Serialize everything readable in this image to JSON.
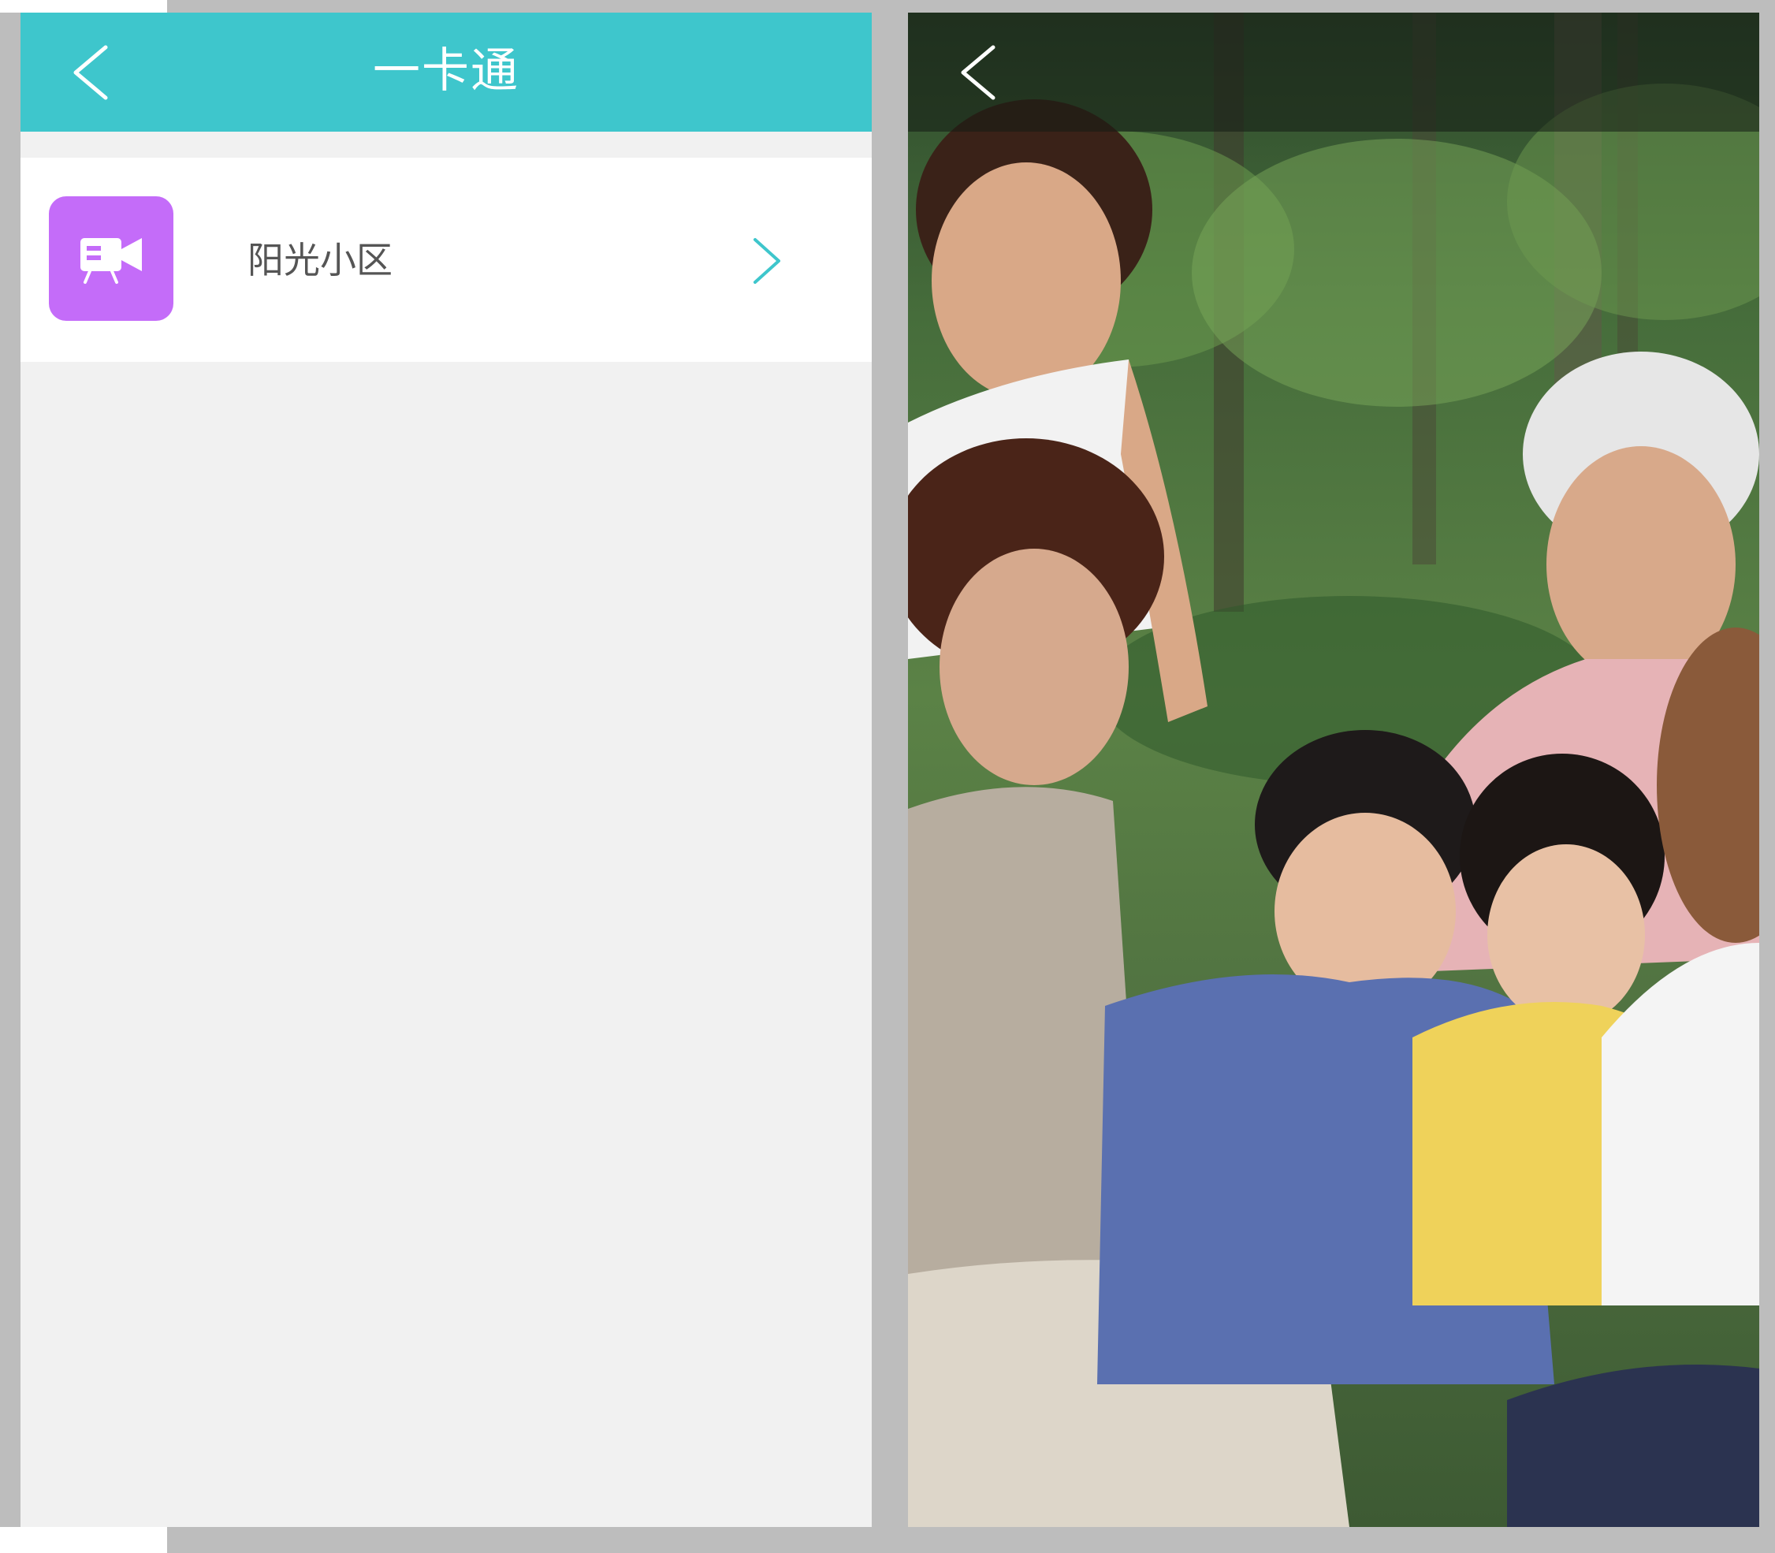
{
  "left_screen": {
    "nav": {
      "title": "一卡通",
      "back_icon": "chevron-left-icon"
    },
    "list": [
      {
        "label": "阳光小区",
        "icon": "video-camera-icon",
        "arrow": "chevron-right-icon"
      }
    ]
  },
  "right_screen": {
    "nav": {
      "back_icon": "chevron-left-icon"
    },
    "photo": "family-outdoor-photo"
  },
  "colors": {
    "accent": "#3ec6cc",
    "icon_bg": "#c46cf9",
    "page_bg": "#f1f1f1",
    "frame": "#bdbdbd"
  }
}
